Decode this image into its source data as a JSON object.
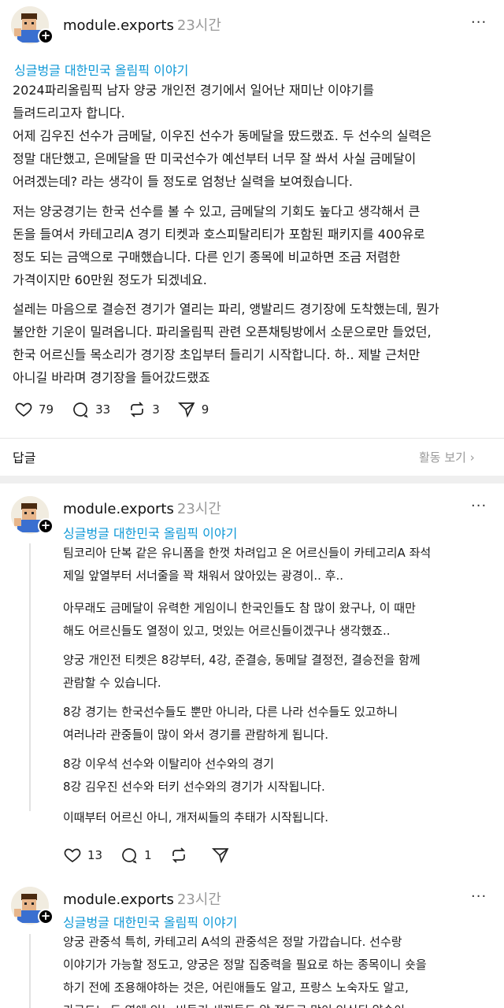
{
  "posts": [
    {
      "author": "module.exports",
      "time": "23시간",
      "topic": "싱글벙글 대한민국 올림픽 이야기",
      "lines": [
        "2024파리올림픽 남자 양궁 개인전 경기에서 일어난 재미난 이야기를",
        "들려드리고자 합니다.",
        "어제 김우진 선수가 금메달, 이우진 선수가 동메달을 땄드랬죠. 두 선수의 실력은",
        "정말 대단했고, 은메달을 딴 미국선수가 예선부터 너무 잘 쏴서 사실 금메달이",
        "어려겠는데? 라는 생각이 들 정도로 엄청난 실력을 보여줬습니다.",
        "저는 양궁경기는 한국 선수를 볼 수 있고, 금메달의 기회도 높다고 생각해서 큰",
        "돈을 들여서 카테고리A 경기 티켓과 호스피탈리티가 포함된 패키지를 400유로",
        "정도 되는 금액으로 구매했습니다. 다른 인기 종목에 비교하면 조금 저렴한",
        "가격이지만 60만원 정도가 되겠네요.",
        "설레는 마음으로 결승전 경기가 열리는 파리, 앵발리드 경기장에 도착했는데, 뭔가",
        "불안한 기운이 밀려옵니다. 파리올림픽 관련 오픈채팅방에서 소문으로만 들었던,",
        "한국 어르신들 목소리가 경기장 초입부터 들리기 시작합니다. 하.. 제발 근처만",
        "아니길 바라며 경기장을 들어갔드랬죠"
      ],
      "likes": "79",
      "comments": "33",
      "reposts": "3",
      "shares": "9"
    },
    {
      "author": "module.exports",
      "time": "23시간",
      "topic": "싱글벙글 대한민국 올림픽 이야기",
      "lines": [
        "팀코리아 단복 같은 유니폼을 한껏 차려입고 온 어르신들이 카테고리A 좌석",
        "제일 앞열부터 서너줄을 꽉 채워서 앉아있는 광경이.. 후..",
        "아무래도 금메달이 유력한 게임이니 한국인들도 참 많이 왔구나, 이 때만",
        "해도 어르신들도 열정이 있고, 멋있는 어르신들이겠구나 생각했죠..",
        "양궁 개인전 티켓은 8강부터, 4강, 준결승, 동메달 결정전, 결승전을 함께",
        "관람할 수 있습니다.",
        "8강 경기는 한국선수들도 뿐만 아니라, 다른 나라 선수들도 있고하니",
        "여러나라 관중들이 많이 와서 경기를 관람하게 됩니다.",
        "8강 이우석 선수와 이탈리아 선수와의 경기",
        "8강 김우진 선수와 터키 선수와의 경기가 시작됩니다.",
        "이때부터 어르신 아니, 개저씨들의 추태가 시작됩니다."
      ],
      "likes": "13",
      "comments": "1"
    },
    {
      "author": "module.exports",
      "time": "23시간",
      "topic": "싱글벙글 대한민국 올림픽 이야기",
      "lines": [
        "양궁 관중석 특히, 카테고리 A석의 관중석은 정말 가깝습니다. 선수랑",
        "이야기가 가능할 정도고, 양궁은 정말 집중력을 필요로 하는 종목이니 숏을",
        "하기 전에 조용해야하는 것은, 어린애들도 알고, 프랑스 노숙자도 알고,",
        "가르드느 도 옆에 있는 비둘기 새끼들도 알 정도로 많이 인식된 약속이"
      ]
    }
  ],
  "reply_label": "답글",
  "activity_label": "활동 보기 ›",
  "more_icon": "more-dots-icon",
  "colors": {
    "topic": "#0c97d6",
    "time": "#999999"
  }
}
